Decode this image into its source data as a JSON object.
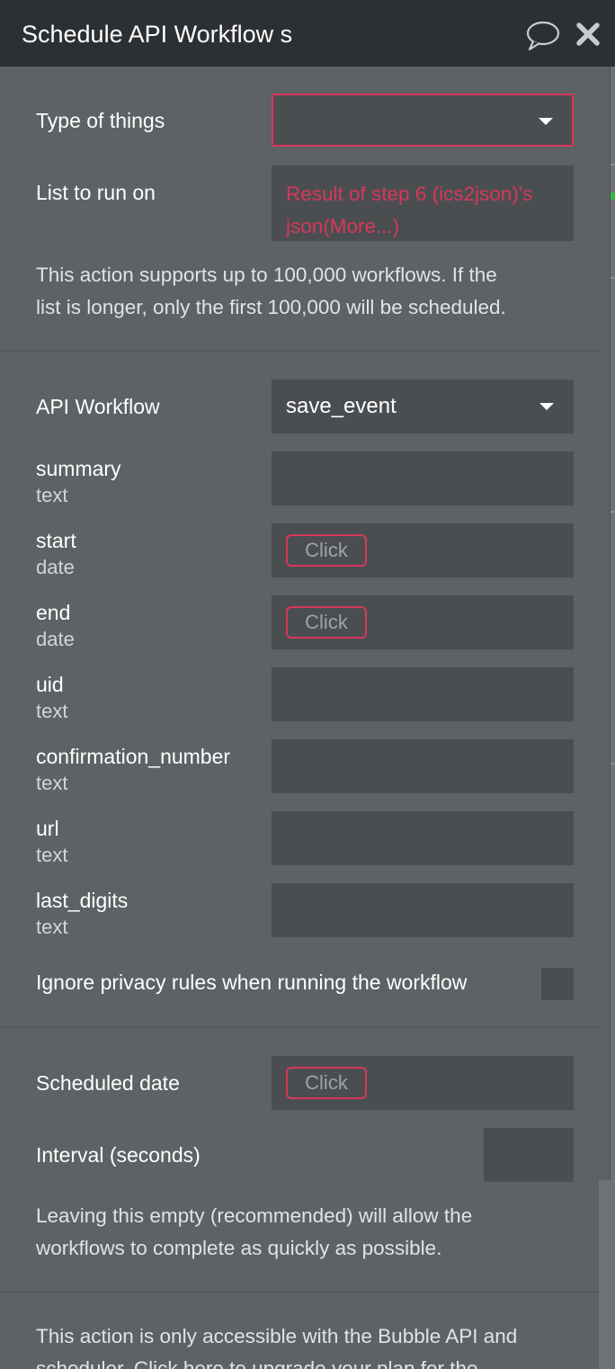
{
  "header": {
    "title": "Schedule API Workflow s",
    "comment_icon": "speech-bubble-icon",
    "close_icon": "close-icon"
  },
  "type_of_things": {
    "label": "Type of things",
    "value": ""
  },
  "list_to_run_on": {
    "label": "List to run on",
    "value_line1": "Result of step 6 (ics2json)'s",
    "value_line2": "json(More...)"
  },
  "limit_note": {
    "line1": "This action supports up to 100,000 workflows. If the",
    "line2": "list is longer, only the first 100,000 will be scheduled."
  },
  "api_workflow": {
    "label": "API Workflow",
    "value": "save_event"
  },
  "parameters": [
    {
      "name": "summary",
      "type": "text",
      "value": ""
    },
    {
      "name": "start",
      "type": "date",
      "button": "Click"
    },
    {
      "name": "end",
      "type": "date",
      "button": "Click"
    },
    {
      "name": "uid",
      "type": "text",
      "value": ""
    },
    {
      "name": "confirmation_number",
      "type": "text",
      "value": ""
    },
    {
      "name": "url",
      "type": "text",
      "value": ""
    },
    {
      "name": "last_digits",
      "type": "text",
      "value": ""
    }
  ],
  "ignore_privacy": {
    "label": "Ignore privacy rules when running the workflow",
    "checked": false
  },
  "scheduled_date": {
    "label": "Scheduled date",
    "button": "Click"
  },
  "interval": {
    "label": "Interval (seconds)",
    "value": ""
  },
  "interval_note": {
    "line1": "Leaving this empty (recommended) will allow the",
    "line2": "workflows to complete as quickly as possible."
  },
  "upgrade_note": {
    "line1": "This action is only accessible with the Bubble API and",
    "line2": "scheduler. Click here to upgrade your plan for the"
  },
  "colors": {
    "header_bg": "#2d3033",
    "panel_bg": "#5e6265",
    "field_bg": "#4b4e51",
    "accent_red": "#d8375a",
    "text_white": "#ffffff"
  }
}
